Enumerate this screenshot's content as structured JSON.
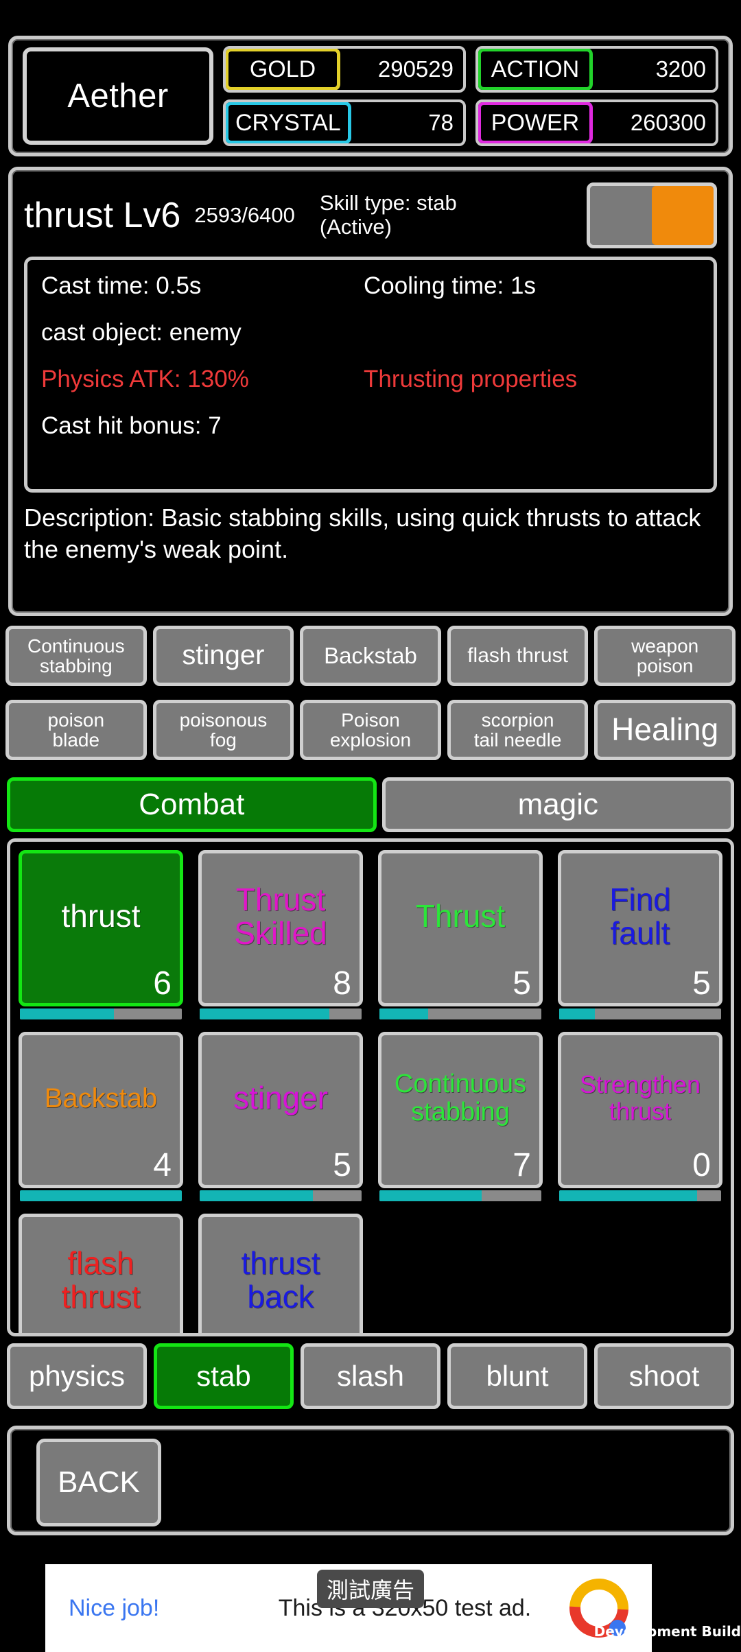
{
  "header": {
    "player_name": "Aether",
    "stats": [
      {
        "key": "gold",
        "label": "GOLD",
        "value": "290529",
        "color": "#e3d02a"
      },
      {
        "key": "action",
        "label": "ACTION",
        "value": "3200",
        "color": "#22d32b"
      },
      {
        "key": "crystal",
        "label": "CRYSTAL",
        "value": "78",
        "color": "#28c8e6"
      },
      {
        "key": "power",
        "label": "POWER",
        "value": "260300",
        "color": "#e02ae0"
      }
    ]
  },
  "detail": {
    "skill_name": "thrust Lv6",
    "exp": "2593/6400",
    "skill_type": "Skill type: stab\n(Active)",
    "toggle_state": "on",
    "toggle_on_color": "#f08a0c",
    "cast_time": "Cast time: 0.5s",
    "cooling_time": "Cooling time: 1s",
    "cast_object": "cast object: enemy",
    "physics_atk": "Physics ATK: 130%",
    "properties": "Thrusting properties",
    "highlight_color": "#ef3a3a",
    "cast_hit_bonus": "Cast hit bonus: 7",
    "description": "Description: Basic stabbing skills, using quick thrusts to attack the enemy's weak point."
  },
  "related_skills": {
    "row1": [
      {
        "label": "Continuous\nstabbing",
        "size": "s1"
      },
      {
        "label": "stinger",
        "size": "s2"
      },
      {
        "label": "Backstab",
        "size": "s3"
      },
      {
        "label": "flash thrust",
        "size": "s4"
      },
      {
        "label": "weapon\npoison",
        "size": "s1"
      }
    ],
    "row2": [
      {
        "label": "poison\nblade",
        "size": "s1"
      },
      {
        "label": "poisonous\nfog",
        "size": "s1"
      },
      {
        "label": "Poison\nexplosion",
        "size": "s1"
      },
      {
        "label": "scorpion\ntail needle",
        "size": "s1"
      },
      {
        "label": "Healing",
        "size": "s5"
      }
    ]
  },
  "category_tabs": [
    {
      "label": "Combat",
      "selected": true
    },
    {
      "label": "magic",
      "selected": false
    }
  ],
  "skill_grid": [
    {
      "label": "thrust",
      "level": "6",
      "color": "#ffffff",
      "font": 46,
      "selected": true,
      "progress": 58
    },
    {
      "label": "Thrust\nSkilled",
      "level": "8",
      "color": "#e016c8",
      "font": 46,
      "selected": false,
      "progress": 80
    },
    {
      "label": "Thrust",
      "level": "5",
      "color": "#2ce63a",
      "font": 46,
      "selected": false,
      "progress": 30
    },
    {
      "label": "Find\nfault",
      "level": "5",
      "color": "#1a1ae0",
      "font": 46,
      "selected": false,
      "progress": 22
    },
    {
      "label": "Backstab",
      "level": "4",
      "color": "#f08a0c",
      "font": 40,
      "selected": false,
      "progress": 100
    },
    {
      "label": "stinger",
      "level": "5",
      "color": "#d614d6",
      "font": 46,
      "selected": false,
      "progress": 70
    },
    {
      "label": "Continuous\nstabbing",
      "level": "7",
      "color": "#2ce63a",
      "font": 38,
      "selected": false,
      "progress": 63
    },
    {
      "label": "Strengthen\nthrust",
      "level": "0",
      "color": "#d614d6",
      "font": 36,
      "selected": false,
      "progress": 85
    },
    {
      "label": "flash\nthrust",
      "level": "",
      "color": "#ef2020",
      "font": 46,
      "selected": false,
      "progress": 0
    },
    {
      "label": "thrust\nback",
      "level": "",
      "color": "#1a1ae0",
      "font": 46,
      "selected": false,
      "progress": 0
    }
  ],
  "type_tabs": [
    {
      "label": "physics",
      "selected": false
    },
    {
      "label": "stab",
      "selected": true
    },
    {
      "label": "slash",
      "selected": false
    },
    {
      "label": "blunt",
      "selected": false
    },
    {
      "label": "shoot",
      "selected": false
    }
  ],
  "bottom": {
    "back_label": "BACK"
  },
  "ad": {
    "badge": "測試廣告",
    "cta": "Nice job!",
    "text": "This is a 320x50 test ad.",
    "watermark": "Development Build"
  }
}
